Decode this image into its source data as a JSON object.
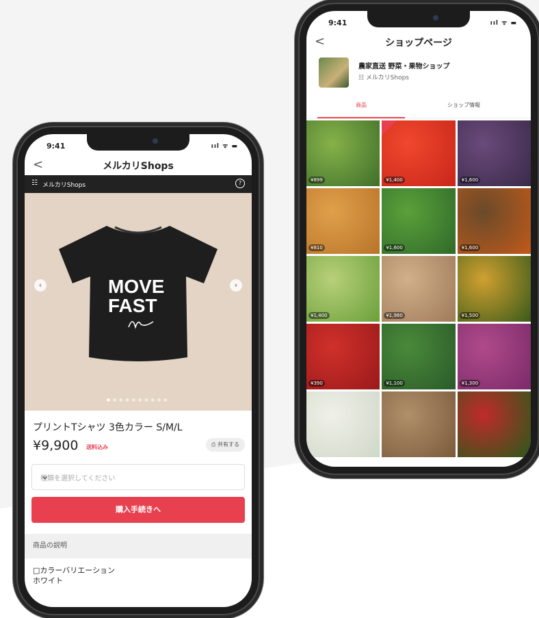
{
  "left_phone": {
    "status": {
      "time": "9:41",
      "icons": "ııl ᯤ ▬"
    },
    "nav": {
      "back": "<",
      "title": "メルカリShops"
    },
    "shop_bar": {
      "logo": "☷",
      "name": "メルカリShops",
      "help": "?"
    },
    "product_image": {
      "text_line1": "MOVE",
      "text_line2": "FAST",
      "prev": "‹",
      "next": "›",
      "dots_active": "●",
      "dots_rest": "●●●●●●●●●"
    },
    "product": {
      "title": "プリントTシャツ 3色カラー S/M/L",
      "price": "¥9,900",
      "shipping": "送料込み",
      "share_label": "⎙ 共有する",
      "select_placeholder": "種類を選択してください",
      "select_chevron": "⌄",
      "buy_label": "購入手続きへ",
      "desc_heading": "商品の説明",
      "desc_line1": "□カラーバリエーション",
      "desc_line2": "ホワイト"
    }
  },
  "right_phone": {
    "status": {
      "time": "9:41",
      "icons": "ııl ᯤ ▬"
    },
    "nav": {
      "back": "<",
      "title": "ショップページ"
    },
    "shop": {
      "name": "農家直送 野菜・果物ショップ",
      "badge": "☷ メルカリShops"
    },
    "tabs": [
      {
        "label": "商品"
      },
      {
        "label": "ショップ情報"
      }
    ],
    "items": [
      {
        "price": "¥899",
        "colors": [
          "#3f6f2a",
          "#86b24a"
        ]
      },
      {
        "price": "¥1,400",
        "colors": [
          "#c9261a",
          "#f0482e"
        ]
      },
      {
        "price": "¥1,600",
        "colors": [
          "#3a2a4a",
          "#6a4a7a"
        ]
      },
      {
        "price": "¥810",
        "colors": [
          "#b8742a",
          "#e0a04a"
        ]
      },
      {
        "price": "¥1,600",
        "colors": [
          "#2f6a2a",
          "#5aa03a"
        ]
      },
      {
        "price": "¥1,600",
        "colors": [
          "#c05a1a",
          "#6a4a2a"
        ]
      },
      {
        "price": "¥1,400",
        "colors": [
          "#6aa03a",
          "#b8d07a"
        ]
      },
      {
        "price": "¥1,980",
        "colors": [
          "#a07a5a",
          "#d0b08a"
        ]
      },
      {
        "price": "¥1,500",
        "colors": [
          "#3a5a1a",
          "#d0a030"
        ]
      },
      {
        "price": "¥390",
        "colors": [
          "#9a1a1a",
          "#d0302a"
        ]
      },
      {
        "price": "¥1,100",
        "colors": [
          "#2a5a2a",
          "#4a8a3a"
        ]
      },
      {
        "price": "¥1,300",
        "colors": [
          "#7a2a6a",
          "#b04a8a"
        ]
      },
      {
        "price": "",
        "colors": [
          "#cfd8c8",
          "#f0f0e8"
        ]
      },
      {
        "price": "",
        "colors": [
          "#7a5a3a",
          "#b0906a"
        ]
      },
      {
        "price": "",
        "colors": [
          "#2a5a1a",
          "#c02a2a"
        ]
      }
    ]
  },
  "colors": {
    "accent": "#e94050",
    "dark": "#222222"
  }
}
